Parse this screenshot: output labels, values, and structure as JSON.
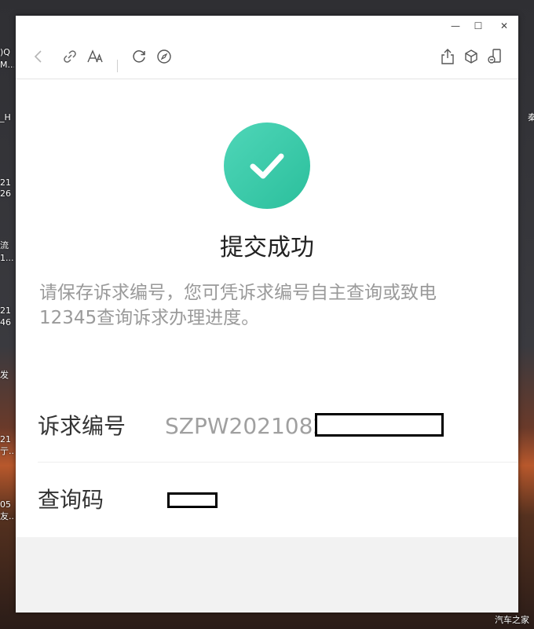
{
  "desktop": {
    "left_labels": [
      ")Q",
      "M...",
      "_H",
      "21",
      "26",
      "流",
      "1...",
      "21",
      "46",
      "发",
      "21",
      "亍...",
      "05",
      "友..."
    ],
    "right_labels": [
      "秦"
    ],
    "watermark": "汽车之家"
  },
  "window": {
    "controls": {
      "minimize": "—",
      "maximize": "☐",
      "close": "✕"
    }
  },
  "result": {
    "title": "提交成功",
    "hint": "请保存诉求编号，您可凭诉求编号自主查询或致电12345查询诉求办理进度。",
    "fields": [
      {
        "label": "诉求编号",
        "value": "SZPW2021082"
      },
      {
        "label": "查询码",
        "value": ""
      }
    ]
  },
  "icons": {
    "toolbar": [
      "back-icon",
      "link-icon",
      "font-size-icon",
      "refresh-icon",
      "compass-icon",
      "share-icon",
      "cube-icon",
      "phone-mirror-icon"
    ],
    "status": "checkmark-icon"
  },
  "colors": {
    "success": "#2bbf9c",
    "hint": "#9a9a9a",
    "value": "#a0a0a0"
  }
}
